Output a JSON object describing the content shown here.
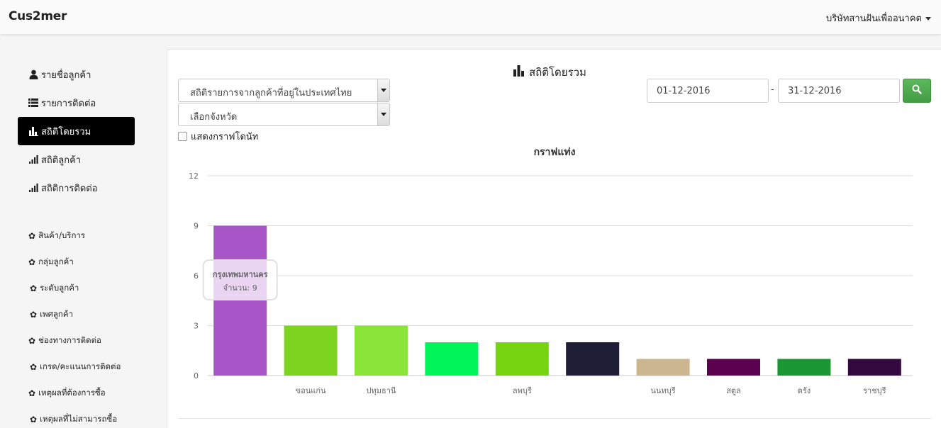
{
  "navbar": {
    "brand": "Cus2mer",
    "company": "บริษัทสานฝันเพื่ออนาคต"
  },
  "sidebar": {
    "main_items": [
      {
        "label": "รายชื่อลูกค้า",
        "icon": "user-icon",
        "active": false
      },
      {
        "label": "รายการติดต่อ",
        "icon": "list-icon",
        "active": false
      },
      {
        "label": "สถิติโดยรวม",
        "icon": "bar-chart-icon",
        "active": true
      },
      {
        "label": "สถิติลูกค้า",
        "icon": "signal-icon",
        "active": false
      },
      {
        "label": "สถิติการติดต่อ",
        "icon": "signal-icon",
        "active": false
      }
    ],
    "settings_items": [
      {
        "label": "สินค้า/บริการ",
        "icon": "gear-icon"
      },
      {
        "label": "กลุ่มลูกค้า",
        "icon": "gear-icon"
      },
      {
        "label": "ระดับลูกค้า",
        "icon": "gear-icon"
      },
      {
        "label": "เพศลูกค้า",
        "icon": "gear-icon"
      },
      {
        "label": "ช่องทางการติดต่อ",
        "icon": "gear-icon"
      },
      {
        "label": "เกรด/คะแนนการติดต่อ",
        "icon": "gear-icon"
      },
      {
        "label": "เหตุผลที่ต้องการซื้อ",
        "icon": "gear-icon"
      },
      {
        "label": "เหตุผลที่ไม่สามารถซื้อ",
        "icon": "gear-icon"
      }
    ]
  },
  "main": {
    "title": "สถิติโดยรวม",
    "stat_select": "สถิติรายการจากลูกค้าที่อยู่ในประเทศไทย",
    "province_select": "เลือกจังหวัด",
    "donut_checkbox_label": "แสดงกราฟโดนัท",
    "date_from": "01-12-2016",
    "date_separator": "-",
    "date_to": "31-12-2016",
    "chart_heading": "กราฟแท่ง"
  },
  "tooltip": {
    "title": "กรุงเทพมหานคร",
    "value_text": "จำนวน: 9"
  },
  "chart_data": {
    "type": "bar",
    "categories": [
      "กรุงเทพมหานคร",
      "ขอนแก่น",
      "ปทุมธานี",
      "",
      "ลพบุรี",
      "",
      "นนทบุรี",
      "สตูล",
      "ตรัง",
      "ราชบุรี"
    ],
    "visible_category_labels": [
      "",
      "ขอนแก่น",
      "ปทุมธานี",
      "",
      "ลพบุรี",
      "",
      "นนทบุรี",
      "สตูล",
      "ตรัง",
      "ราชบุรี"
    ],
    "values": [
      9,
      3,
      3,
      2,
      2,
      2,
      1,
      1,
      1,
      1
    ],
    "colors": [
      "#a855c8",
      "#7ed320",
      "#8be43a",
      "#00f55a",
      "#77d410",
      "#1e1e36",
      "#cbb68f",
      "#5c0050",
      "#1a9632",
      "#33083f"
    ],
    "ylim": [
      0,
      12
    ],
    "yticks": [
      0,
      3,
      6,
      9,
      12
    ],
    "grid": true
  }
}
